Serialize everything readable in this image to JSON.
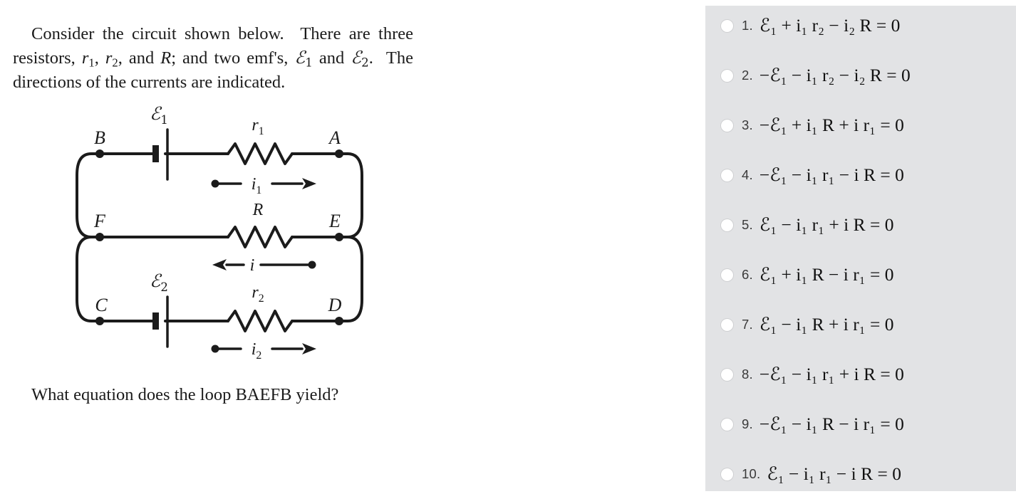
{
  "problem": {
    "intro_text": "Consider the circuit shown below. There are three resistors, r1, r2, and R; and two emf's, E1 and E2. The directions of the currents are indicated.",
    "question_text": "What equation does the loop BAEFB yield?",
    "loop_name": "BAEFB"
  },
  "circuit": {
    "nodes": [
      {
        "id": "B",
        "label": "B"
      },
      {
        "id": "A",
        "label": "A"
      },
      {
        "id": "F",
        "label": "F"
      },
      {
        "id": "E",
        "label": "E"
      },
      {
        "id": "C",
        "label": "C"
      },
      {
        "id": "D",
        "label": "D"
      }
    ],
    "resistors": [
      {
        "id": "r1",
        "label": "r",
        "sub": "1",
        "branch": "top"
      },
      {
        "id": "R",
        "label": "R",
        "sub": "",
        "branch": "middle"
      },
      {
        "id": "r2",
        "label": "r",
        "sub": "2",
        "branch": "bottom"
      }
    ],
    "batteries": [
      {
        "id": "emf1",
        "label": "ℰ",
        "sub": "1",
        "branch": "top"
      },
      {
        "id": "emf2",
        "label": "ℰ",
        "sub": "2",
        "branch": "bottom"
      }
    ],
    "currents": [
      {
        "id": "i1",
        "label": "i",
        "sub": "1",
        "branch": "top",
        "direction": "right"
      },
      {
        "id": "i",
        "label": "i",
        "sub": "",
        "branch": "middle",
        "direction": "left"
      },
      {
        "id": "i2",
        "label": "i",
        "sub": "2",
        "branch": "bottom",
        "direction": "right"
      }
    ]
  },
  "options": [
    {
      "number": "1.",
      "equation": "ℰ₁ + i₁ r₂ − i₂ R = 0",
      "selected": false
    },
    {
      "number": "2.",
      "equation": "−ℰ₁ − i₁ r₂ − i₂ R = 0",
      "selected": false
    },
    {
      "number": "3.",
      "equation": "−ℰ₁ + i₁ R + i r₁ = 0",
      "selected": false
    },
    {
      "number": "4.",
      "equation": "−ℰ₁ − i₁ r₁ − i R = 0",
      "selected": false
    },
    {
      "number": "5.",
      "equation": "ℰ₁ − i₁ r₁ + i R = 0",
      "selected": false
    },
    {
      "number": "6.",
      "equation": "ℰ₁ + i₁ R − i r₁ = 0",
      "selected": false
    },
    {
      "number": "7.",
      "equation": "ℰ₁ − i₁ R + i r₁ = 0",
      "selected": false
    },
    {
      "number": "8.",
      "equation": "−ℰ₁ − i₁ r₁ + i R = 0",
      "selected": false
    },
    {
      "number": "9.",
      "equation": "−ℰ₁ − i₁ R − i r₁ = 0",
      "selected": false
    },
    {
      "number": "10.",
      "equation": "ℰ₁ − i₁ r₁ − i R = 0",
      "selected": false
    }
  ],
  "colors": {
    "panel_background": "#e2e3e5",
    "page_background": "#ffffff",
    "text": "#1b1b1b",
    "radio_fill": "#ffffff",
    "radio_border": "#cfd0d2",
    "wire": "#1b1b1b"
  }
}
